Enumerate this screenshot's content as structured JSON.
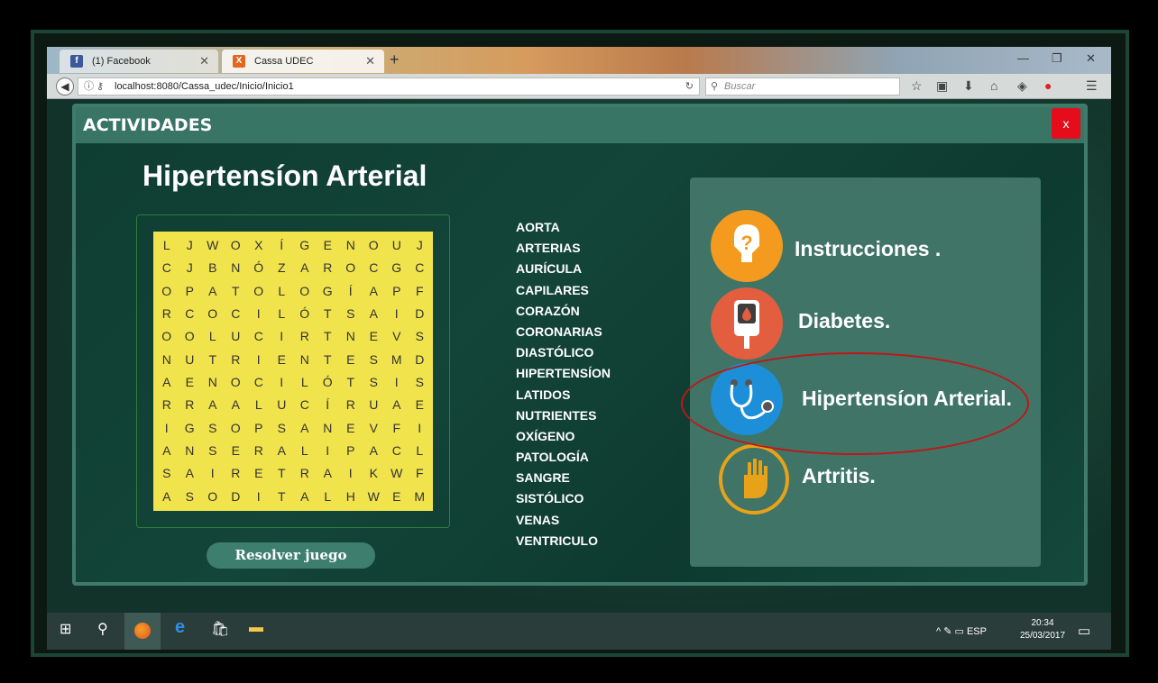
{
  "browser": {
    "tabs": [
      {
        "label": "(1) Facebook",
        "fav": "f",
        "fav_color": "#3b5998"
      },
      {
        "label": "Cassa UDEC",
        "fav": "X",
        "fav_color": "#e2671c"
      }
    ],
    "new_tab": "+",
    "url": "localhost:8080/Cassa_udec/Inicio/Inicio1",
    "search_placeholder": "Buscar"
  },
  "modal": {
    "title": "ACTIVIDADES",
    "close_label": "x",
    "game_title": "Hipertensíon Arterial",
    "grid": [
      [
        "L",
        "J",
        "W",
        "O",
        "X",
        "Í",
        "G",
        "E",
        "N",
        "O",
        "U",
        "J"
      ],
      [
        "C",
        "J",
        "B",
        "N",
        "Ó",
        "Z",
        "A",
        "R",
        "O",
        "C",
        "G",
        "C"
      ],
      [
        "O",
        "P",
        "A",
        "T",
        "O",
        "L",
        "O",
        "G",
        "Í",
        "A",
        "P",
        "F"
      ],
      [
        "R",
        "C",
        "O",
        "C",
        "I",
        "L",
        "Ó",
        "T",
        "S",
        "A",
        "I",
        "D"
      ],
      [
        "O",
        "O",
        "L",
        "U",
        "C",
        "I",
        "R",
        "T",
        "N",
        "E",
        "V",
        "S"
      ],
      [
        "N",
        "U",
        "T",
        "R",
        "I",
        "E",
        "N",
        "T",
        "E",
        "S",
        "M",
        "D"
      ],
      [
        "A",
        "E",
        "N",
        "O",
        "C",
        "I",
        "L",
        "Ó",
        "T",
        "S",
        "I",
        "S"
      ],
      [
        "R",
        "R",
        "A",
        "A",
        "L",
        "U",
        "C",
        "Í",
        "R",
        "U",
        "A",
        "E"
      ],
      [
        "I",
        "G",
        "S",
        "O",
        "P",
        "S",
        "A",
        "N",
        "E",
        "V",
        "F",
        "I"
      ],
      [
        "A",
        "N",
        "S",
        "E",
        "R",
        "A",
        "L",
        "I",
        "P",
        "A",
        "C",
        "L"
      ],
      [
        "S",
        "A",
        "I",
        "R",
        "E",
        "T",
        "R",
        "A",
        "I",
        "K",
        "W",
        "F"
      ],
      [
        "A",
        "S",
        "O",
        "D",
        "I",
        "T",
        "A",
        "L",
        "H",
        "W",
        "E",
        "M"
      ]
    ],
    "words": [
      "AORTA",
      "ARTERIAS",
      "AURÍCULA",
      "CAPILARES",
      "CORAZÓN",
      "CORONARIAS",
      "DIASTÓLICO",
      "HIPERTENSÍON",
      "LATIDOS",
      "NUTRIENTES",
      "OXÍGENO",
      "PATOLOGÍA",
      "SANGRE",
      "SISTÓLICO",
      "VENAS",
      "VENTRICULO"
    ],
    "solve_label": "Resolver juego",
    "menu": [
      {
        "label": "Instrucciones .",
        "icon": "question-icon",
        "color": "#f39a1f"
      },
      {
        "label": "Diabetes.",
        "icon": "glucometer-icon",
        "color": "#e35d3f"
      },
      {
        "label": "Hipertensíon Arterial.",
        "icon": "stethoscope-icon",
        "color": "#1d8fd8"
      },
      {
        "label": "Artritis.",
        "icon": "hand-icon",
        "color": "#e8a21a"
      }
    ]
  },
  "taskbar": {
    "lang": "ESP",
    "time": "20:34",
    "date": "25/03/2017"
  }
}
